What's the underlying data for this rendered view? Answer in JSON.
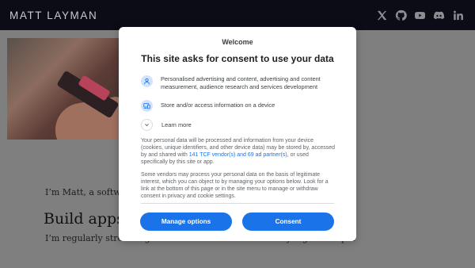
{
  "site": {
    "brand": "MATT LAYMAN",
    "social_icons": [
      "x-icon",
      "github-icon",
      "youtube-icon",
      "discord-icon",
      "linkedin-icon"
    ]
  },
  "page": {
    "intro_text": "I’m Matt, a software",
    "section_title": "Build apps on YouTube",
    "streaming_text": "I’m regularly streaming on YouTube. On most Thursday nights at 6pm"
  },
  "consent": {
    "welcome": "Welcome",
    "headline": "This site asks for consent to use your data",
    "purposes": [
      {
        "icon": "person-icon",
        "label": "Personalised advertising and content, advertising and content measurement, audience research and services development"
      },
      {
        "icon": "device-icon",
        "label": "Store and/or access information on a device"
      }
    ],
    "learn_more": "Learn more",
    "para1_before": "Your personal data will be processed and information from your device (cookies, unique identifiers, and other device data) may be stored by, accessed by and shared with ",
    "para1_link": "141 TCF vendor(s) and 69 ad partner(s)",
    "para1_after": ", or used specifically by this site or app.",
    "para2": "Some vendors may process your personal data on the basis of legitimate interest, which you can object to by managing your options below. Look for a link at the bottom of this page or in the site menu to manage or withdraw consent in privacy and cookie settings.",
    "manage_label": "Manage options",
    "consent_label": "Consent"
  },
  "colors": {
    "accent": "#1a73e8",
    "topbar": "#0c0c17",
    "overlay": "#7f7f7f"
  }
}
